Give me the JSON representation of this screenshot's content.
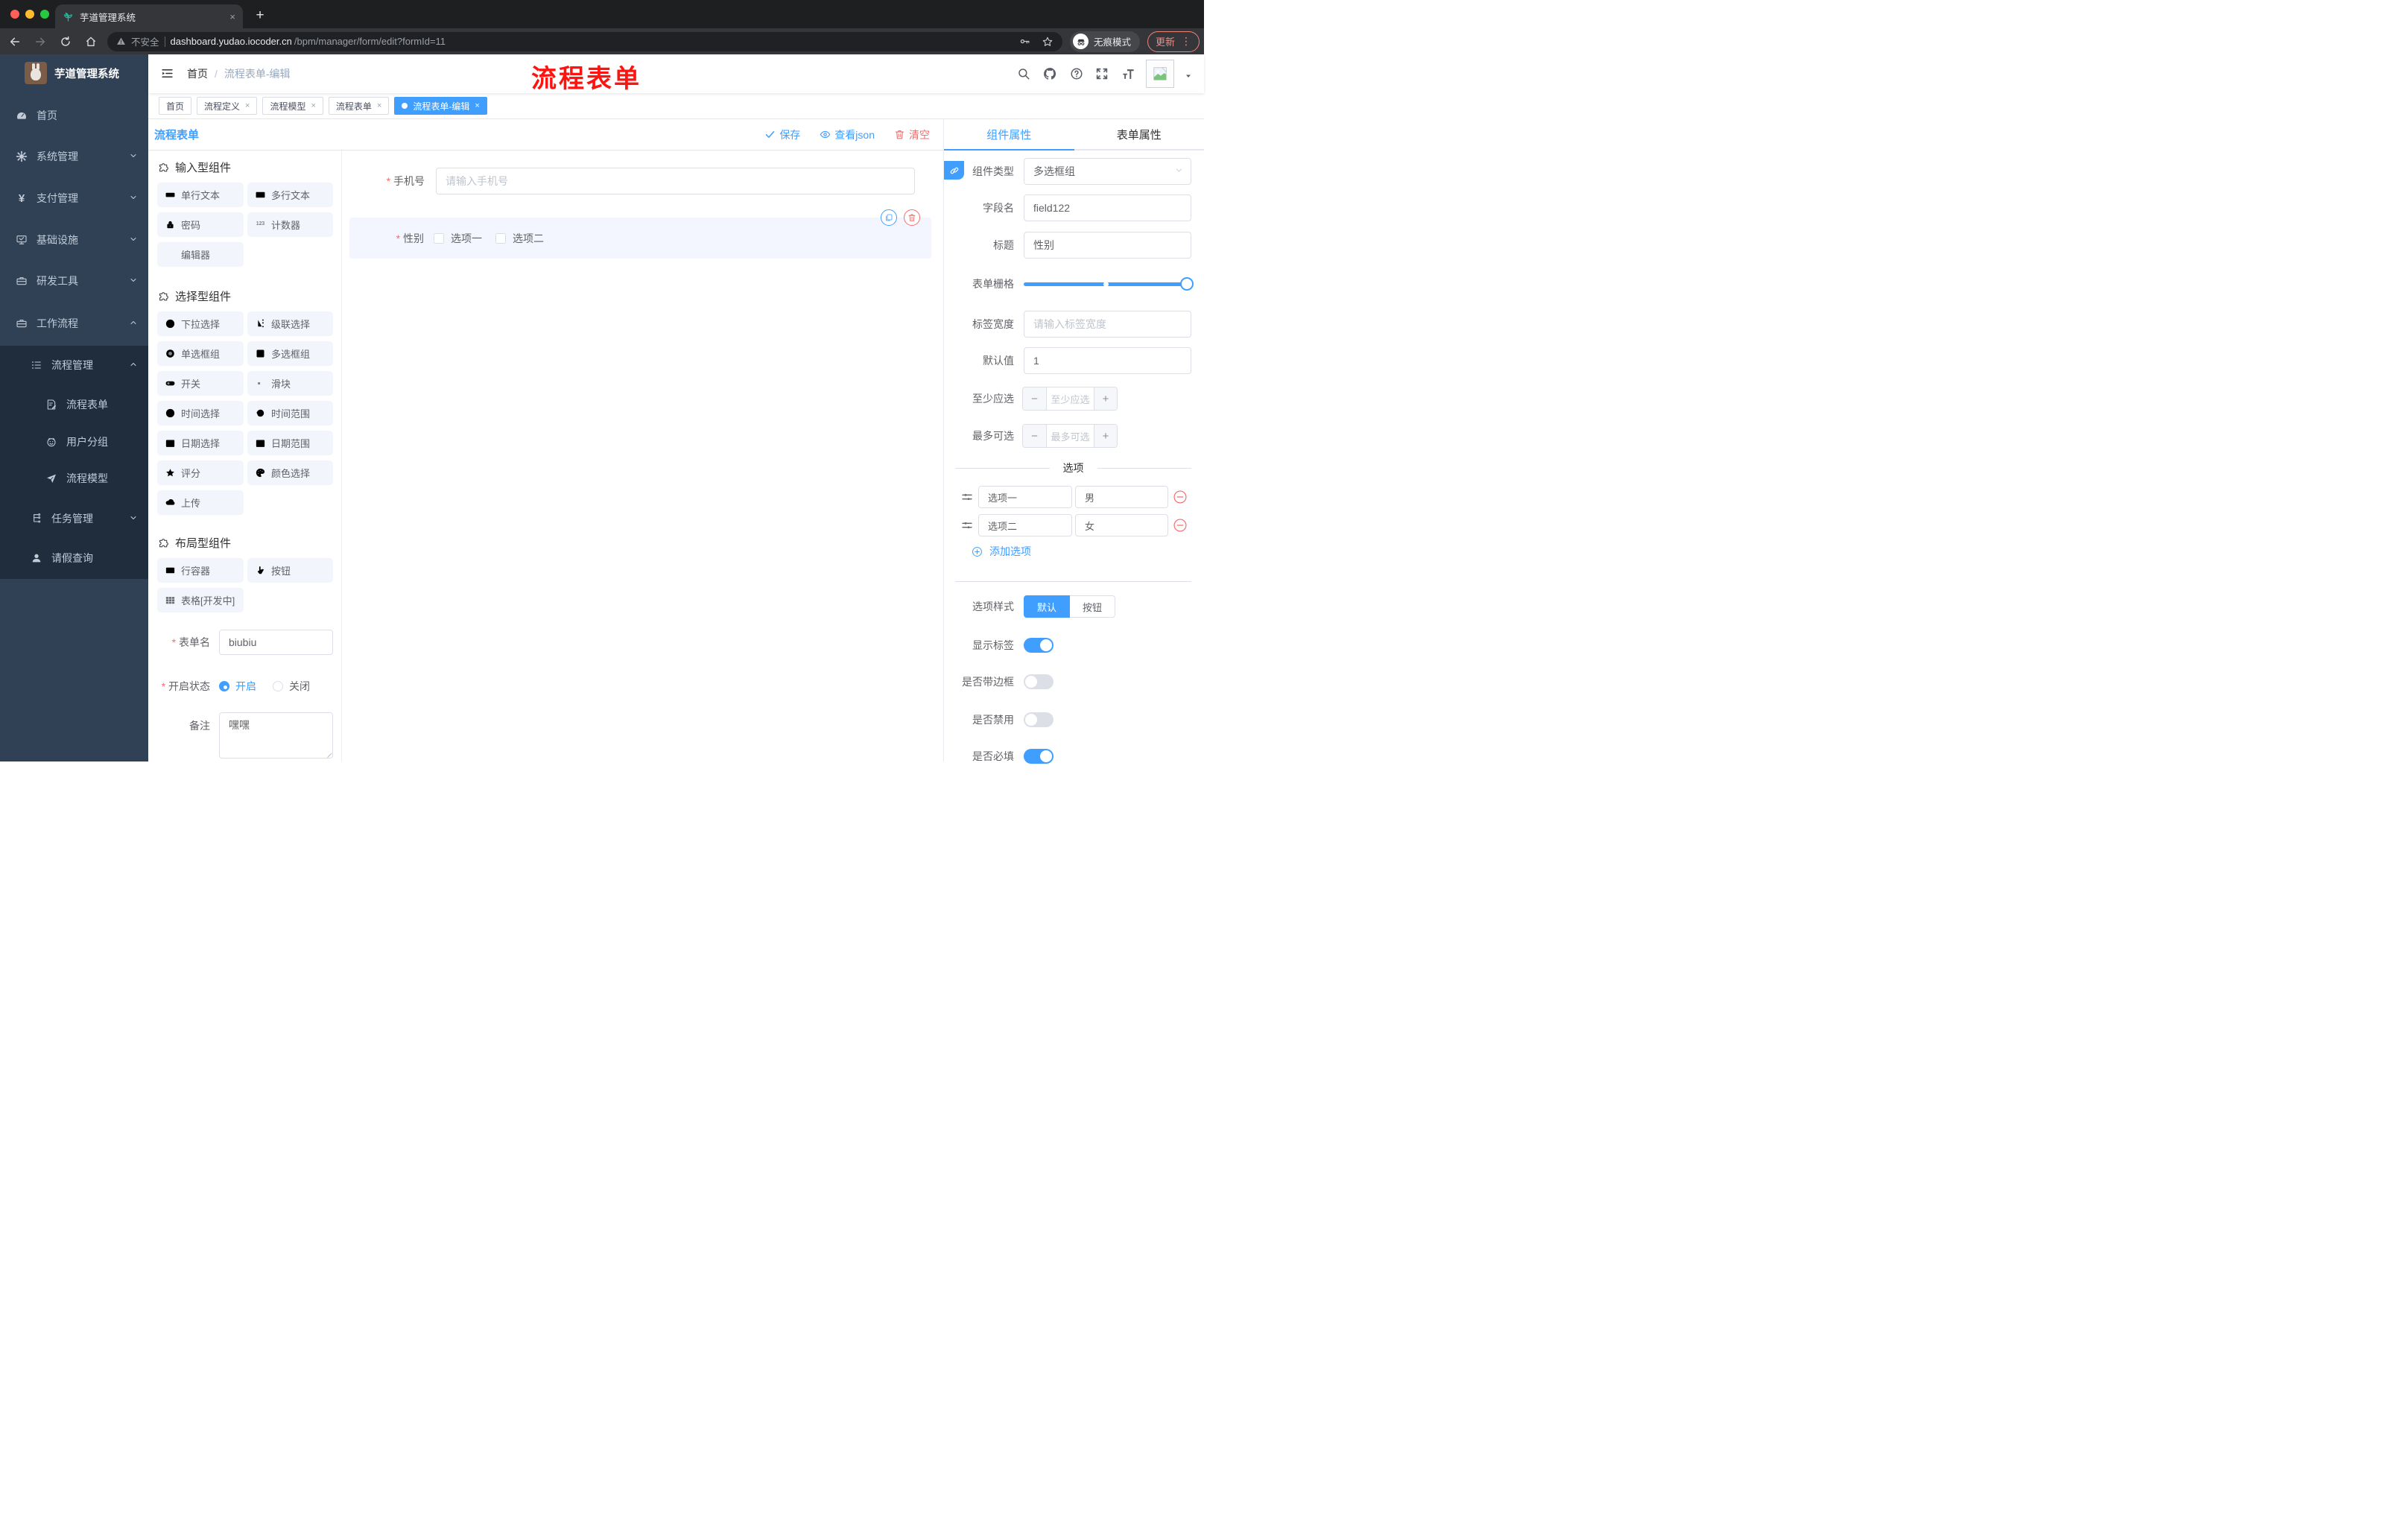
{
  "browser": {
    "tab_title": "芋道管理系统",
    "security_label": "不安全",
    "url_host": "dashboard.yudao.iocoder.cn",
    "url_path": "/bpm/manager/form/edit?formId=11",
    "incognito_label": "无痕模式",
    "update_label": "更新"
  },
  "sidebar": {
    "logo_title": "芋道管理系统",
    "items": [
      {
        "label": "首页",
        "icon": "dashboard-icon",
        "depth": 1
      },
      {
        "label": "系统管理",
        "icon": "gear-icon",
        "depth": 1,
        "chevron": "down"
      },
      {
        "label": "支付管理",
        "icon": "yen-icon",
        "depth": 1,
        "chevron": "down"
      },
      {
        "label": "基础设施",
        "icon": "monitor-icon",
        "depth": 1,
        "chevron": "down"
      },
      {
        "label": "研发工具",
        "icon": "toolbox-icon",
        "depth": 1,
        "chevron": "down"
      },
      {
        "label": "工作流程",
        "icon": "briefcase-icon",
        "depth": 1,
        "chevron": "up"
      },
      {
        "label": "流程管理",
        "icon": "list-icon",
        "depth": 2,
        "chevron": "up"
      },
      {
        "label": "流程表单",
        "icon": "form-edit-icon",
        "depth": 3
      },
      {
        "label": "用户分组",
        "icon": "robot-icon",
        "depth": 3
      },
      {
        "label": "流程模型",
        "icon": "send-icon",
        "depth": 3
      },
      {
        "label": "任务管理",
        "icon": "tree-icon",
        "depth": 2,
        "chevron": "down"
      },
      {
        "label": "请假查询",
        "icon": "user-icon",
        "depth": 2
      }
    ]
  },
  "header": {
    "breadcrumb_home": "首页",
    "breadcrumb_sep": "/",
    "breadcrumb_current": "流程表单-编辑",
    "overlay_title": "流程表单",
    "overlay_color": "#fb1410"
  },
  "tags": {
    "items": [
      {
        "label": "首页",
        "closable": false,
        "active": false
      },
      {
        "label": "流程定义",
        "closable": true,
        "active": false
      },
      {
        "label": "流程模型",
        "closable": true,
        "active": false
      },
      {
        "label": "流程表单",
        "closable": true,
        "active": false
      },
      {
        "label": "流程表单-编辑",
        "closable": true,
        "active": true
      }
    ]
  },
  "toolbar": {
    "title": "流程表单",
    "save_label": "保存",
    "view_json_label": "查看json",
    "clear_label": "清空"
  },
  "palette": {
    "sections": [
      {
        "title": "输入型组件",
        "items": [
          {
            "label": "单行文本",
            "icon": "single-line-text-icon"
          },
          {
            "label": "多行文本",
            "icon": "multi-line-text-icon"
          },
          {
            "label": "密码",
            "icon": "password-lock-icon"
          },
          {
            "label": "计数器",
            "icon": "counter-123-icon"
          },
          {
            "label": "编辑器",
            "icon": ""
          }
        ]
      },
      {
        "title": "选择型组件",
        "items": [
          {
            "label": "下拉选择",
            "icon": "select-dropdown-icon"
          },
          {
            "label": "级联选择",
            "icon": "cascade-icon"
          },
          {
            "label": "单选框组",
            "icon": "radio-icon"
          },
          {
            "label": "多选框组",
            "icon": "checkbox-icon"
          },
          {
            "label": "开关",
            "icon": "switch-icon"
          },
          {
            "label": "滑块",
            "icon": "slider-icon"
          },
          {
            "label": "时间选择",
            "icon": "time-icon"
          },
          {
            "label": "时间范围",
            "icon": "time-range-icon"
          },
          {
            "label": "日期选择",
            "icon": "date-icon"
          },
          {
            "label": "日期范围",
            "icon": "date-range-icon"
          },
          {
            "label": "评分",
            "icon": "rate-star-icon"
          },
          {
            "label": "颜色选择",
            "icon": "color-picker-icon"
          },
          {
            "label": "上传",
            "icon": "upload-icon"
          }
        ]
      },
      {
        "title": "布局型组件",
        "items": [
          {
            "label": "行容器",
            "icon": "row-container-icon"
          },
          {
            "label": "按钮",
            "icon": "button-hand-icon"
          },
          {
            "label": "表格[开发中]",
            "icon": "table-icon"
          }
        ]
      }
    ]
  },
  "meta_form": {
    "name_label": "表单名",
    "name_value": "biubiu",
    "status_label": "开启状态",
    "status_options": [
      "开启",
      "关闭"
    ],
    "status_selected": "开启",
    "remark_label": "备注",
    "remark_value": "嘿嘿"
  },
  "canvas": {
    "phone": {
      "label": "手机号",
      "placeholder": "请输入手机号",
      "required": true
    },
    "gender": {
      "label": "性别",
      "required": true,
      "options": [
        "选项一",
        "选项二"
      ]
    }
  },
  "panel": {
    "tabs": [
      "组件属性",
      "表单属性"
    ],
    "active_tab": "组件属性",
    "component_type_label": "组件类型",
    "component_type_value": "多选框组",
    "field_label": "字段名",
    "field_value": "field122",
    "title_label": "标题",
    "title_value": "性别",
    "grid_label": "表单栅格",
    "grid_value_percent": 100,
    "label_width_label": "标签宽度",
    "label_width_placeholder": "请输入标签宽度",
    "default_label": "默认值",
    "default_value": "1",
    "min_label": "至少应选",
    "min_placeholder": "至少应选",
    "max_label": "最多可选",
    "max_placeholder": "最多可选",
    "options_title": "选项",
    "options": [
      {
        "label": "选项一",
        "value": "男"
      },
      {
        "label": "选项二",
        "value": "女"
      }
    ],
    "add_option_label": "添加选项",
    "style_label": "选项样式",
    "style_options": [
      "默认",
      "按钮"
    ],
    "style_active": "默认",
    "switches": [
      {
        "label": "显示标签",
        "on": true
      },
      {
        "label": "是否带边框",
        "on": false
      },
      {
        "label": "是否禁用",
        "on": false
      },
      {
        "label": "是否必填",
        "on": true
      }
    ]
  },
  "colors": {
    "primary": "#409EFF",
    "danger": "#F56C6C",
    "sidebar_bg": "#304156",
    "sidebar_sub_bg": "#1f2d3d"
  }
}
